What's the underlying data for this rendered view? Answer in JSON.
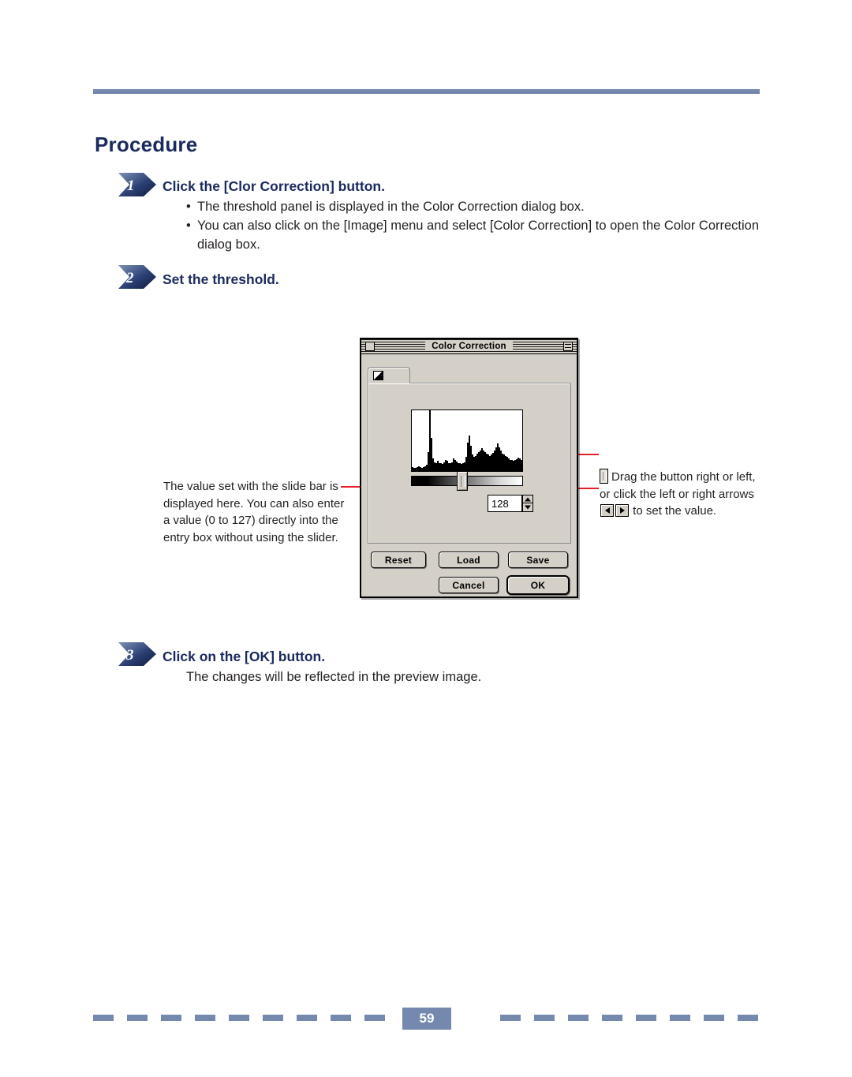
{
  "document": {
    "heading": "Procedure",
    "page_number": "59",
    "accent_color": "#7489ad",
    "heading_color": "#1b2a5e",
    "leader_color": "#e8202a"
  },
  "steps": [
    {
      "number": "1",
      "title": "Click the [Clor Correction] button.",
      "bullets": [
        "The threshold panel is displayed in the Color Correction dialog box.",
        "You can also click on the [Image] menu and select [Color Correction] to open the Color Correction dialog box."
      ]
    },
    {
      "number": "2",
      "title": "Set the threshold.",
      "bullets": []
    },
    {
      "number": "3",
      "title": "Click on the [OK] button.",
      "bullets": [
        "The changes will be reflected in the preview image."
      ]
    }
  ],
  "annotations": {
    "left": "The value set with the slide bar is displayed here.  You can also enter a value (0 to 127) directly into the entry box without using the slider.",
    "right_part1": "Drag the button right or left, or click the left or right arrows",
    "right_part2": "to set the value."
  },
  "dialog": {
    "title": "Color Correction",
    "close_box": "close-box",
    "zoom_box": "zoom-box",
    "value": "128",
    "buttons": {
      "reset": "Reset",
      "load": "Load",
      "save": "Save",
      "cancel": "Cancel",
      "ok": "OK"
    },
    "histogram": {
      "type": "bar",
      "title": "Threshold histogram",
      "xlabel": "",
      "ylabel": "",
      "ylim": [
        0,
        100
      ],
      "values": [
        6,
        5,
        5,
        6,
        7,
        6,
        5,
        6,
        8,
        10,
        30,
        96,
        52,
        20,
        14,
        12,
        16,
        13,
        12,
        11,
        14,
        18,
        16,
        13,
        12,
        14,
        20,
        17,
        15,
        13,
        12,
        11,
        12,
        14,
        22,
        45,
        56,
        40,
        26,
        22,
        24,
        27,
        30,
        33,
        36,
        33,
        30,
        28,
        26,
        24,
        26,
        29,
        33,
        38,
        44,
        38,
        32,
        28,
        26,
        24,
        22,
        20,
        18,
        17,
        16,
        17,
        19,
        21,
        20,
        18
      ]
    },
    "slider": {
      "position_percent": 45,
      "min": 0,
      "max": 127
    }
  }
}
